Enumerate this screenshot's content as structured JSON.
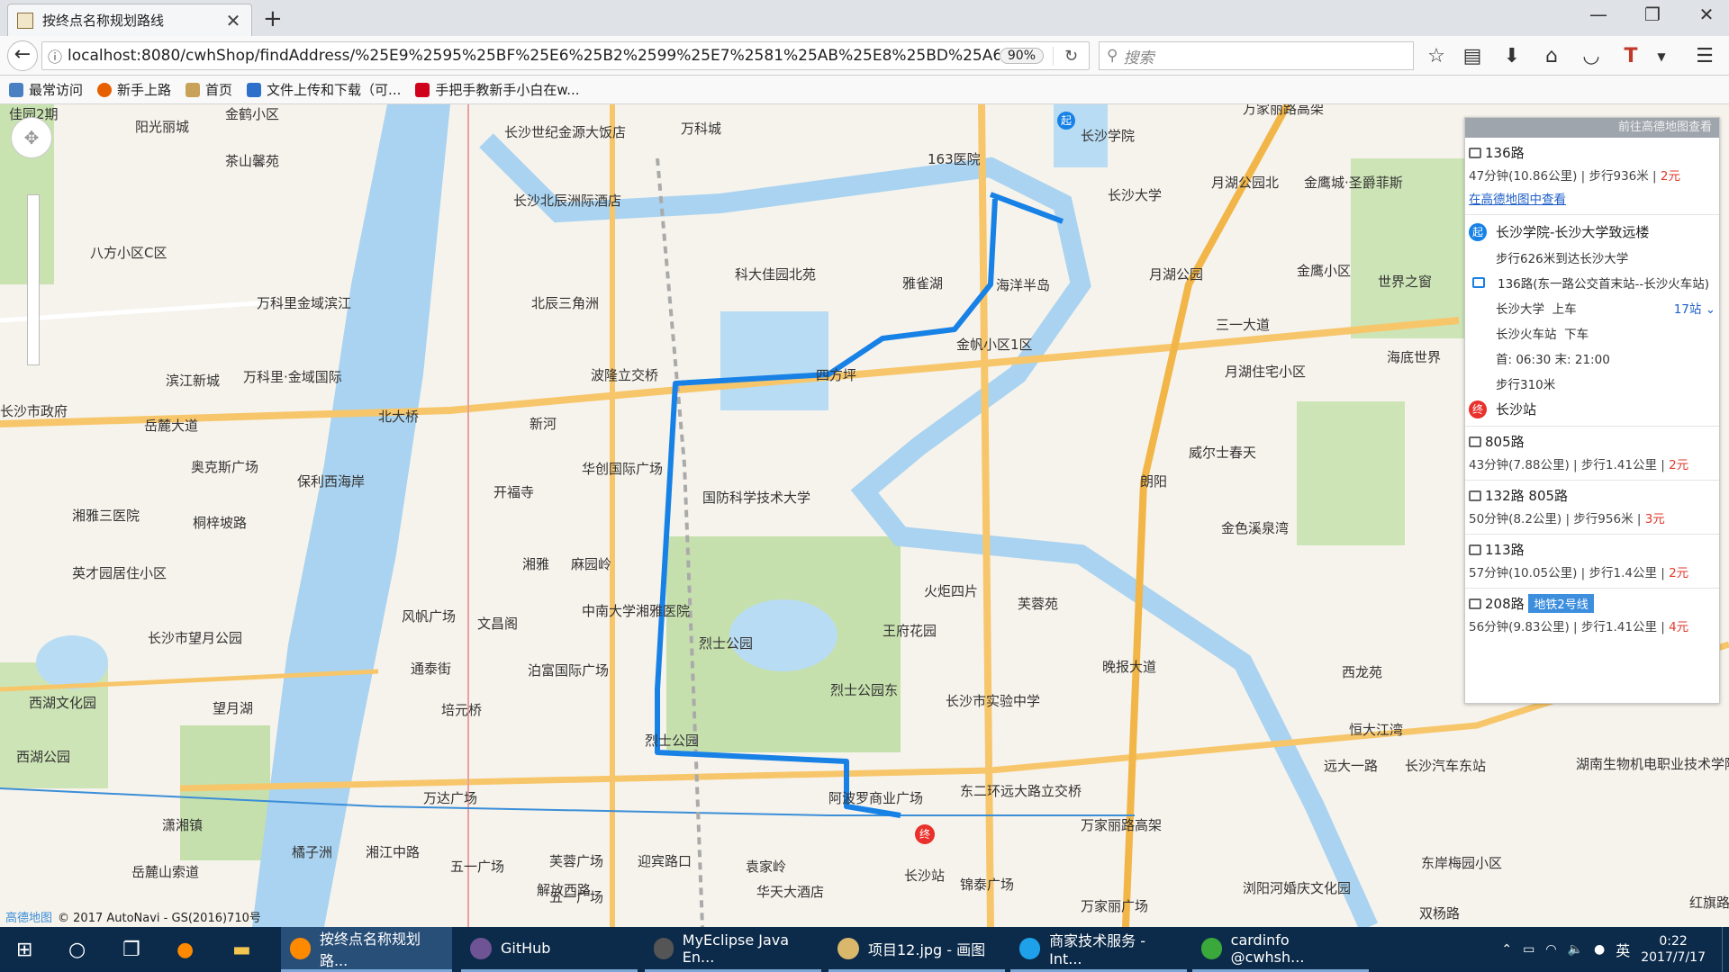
{
  "browser": {
    "tab_title": "按终点名称规划路线",
    "url": "localhost:8080/cwhShop/findAddress/%25E9%2595%25BF%25E6%25B2%2599%25E7%2581%25AB%25E8%25BD%25A6",
    "zoom": "90%",
    "search_placeholder": "搜索",
    "bookmarks": [
      "最常访问",
      "新手上路",
      "首页",
      "文件上传和下载（可...",
      "手把手教新手小白在w..."
    ]
  },
  "map": {
    "labels": [
      "佳园2期",
      "金鹤小区",
      "阳光丽城",
      "长沙世纪金源大饭店",
      "万科城",
      "163医院",
      "长沙学院",
      "万家丽路高架",
      "茶山馨苑",
      "长沙北辰洲际酒店",
      "长沙大学",
      "月湖公园北",
      "金鹰城·圣爵菲斯",
      "八方小区C区",
      "科大佳园北苑",
      "雅雀湖",
      "海洋半岛",
      "金鹰小区",
      "万科里金域滨江",
      "北辰三角洲",
      "月湖公园",
      "世界之窗",
      "滨江新城",
      "万科里·金域国际",
      "波隆立交桥",
      "四方坪",
      "金帆小区1区",
      "三一大道",
      "海底世界",
      "长沙市政府",
      "岳麓大道",
      "北大桥",
      "月湖住宅小区",
      "新河",
      "开福寺",
      "奥克斯广场",
      "保利西海岸",
      "华创国际广场",
      "国防科学技术大学",
      "威尔士春天",
      "湘雅三医院",
      "桐梓坡路",
      "朗阳",
      "英才园居住小区",
      "湘雅",
      "麻园岭",
      "中南大学湘雅医院",
      "火炬四片",
      "芙蓉苑",
      "金色溪泉湾",
      "风帆广场",
      "文昌阁",
      "长沙市望月公园",
      "王府花园",
      "西湖文化园",
      "通泰街",
      "泊富国际广场",
      "烈士公园",
      "烈士公园东",
      "晚报大道",
      "西龙苑",
      "望月湖",
      "培元桥",
      "长沙市实验中学",
      "恒大江湾",
      "西湖公园",
      "烈士公园",
      "五一广场",
      "万达广场",
      "阿波罗商业广场",
      "东二环远大路立交桥",
      "远大一路",
      "长沙汽车东站",
      "湖南生物机电职业技术学院",
      "潇湘镇",
      "橘子洲",
      "湘江中路",
      "五一广场",
      "芙蓉广场",
      "迎宾路口",
      "袁家岭",
      "锦泰广场",
      "万家丽路高架",
      "岳麓山索道",
      "解放西路",
      "华天大酒店",
      "长沙站",
      "浏阳河婚庆文化园",
      "万家丽广场",
      "东岸梅园小区",
      "双杨路",
      "红旗路"
    ],
    "copyright": "© 2017 AutoNavi - GS(2016)710号",
    "logo": "高德地图"
  },
  "panel": {
    "header": "前往高德地图查看",
    "first_route": {
      "name": "136路",
      "meta": "47分钟(10.86公里) | 步行936米 | ",
      "price": "2元",
      "link": "在高德地图中查看"
    },
    "steps": {
      "start_badge": "起",
      "start": "长沙学院-长沙大学致远楼",
      "walk1": "步行626米到达长沙大学",
      "bus_line": "136路(东一路公交首末站--长沙火车站)",
      "board_stop": "长沙大学",
      "board_label": "上车",
      "stops": "17站",
      "alight_stop": "长沙火车站",
      "alight_label": "下车",
      "hours": "首: 06:30 末: 21:00",
      "walk2": "步行310米",
      "end_badge": "终",
      "end": "长沙站"
    },
    "routes": [
      {
        "name": "805路",
        "meta": "43分钟(7.88公里) | 步行1.41公里 | ",
        "price": "2元"
      },
      {
        "name": "132路 805路",
        "meta": "50分钟(8.2公里) | 步行956米 | ",
        "price": "3元"
      },
      {
        "name": "113路",
        "meta": "57分钟(10.05公里) | 步行1.4公里 | ",
        "price": "2元"
      },
      {
        "name": "208路",
        "tag": "地铁2号线",
        "meta": "56分钟(9.83公里) | 步行1.41公里 | ",
        "price": "4元"
      }
    ]
  },
  "taskbar": {
    "apps": [
      "按终点名称规划路...",
      "GitHub",
      "MyEclipse Java En...",
      "项目12.jpg - 画图",
      "商家技术服务 - Int...",
      "cardinfo @cwhsh..."
    ],
    "ime": "英",
    "time": "0:22",
    "date": "2017/7/17"
  }
}
